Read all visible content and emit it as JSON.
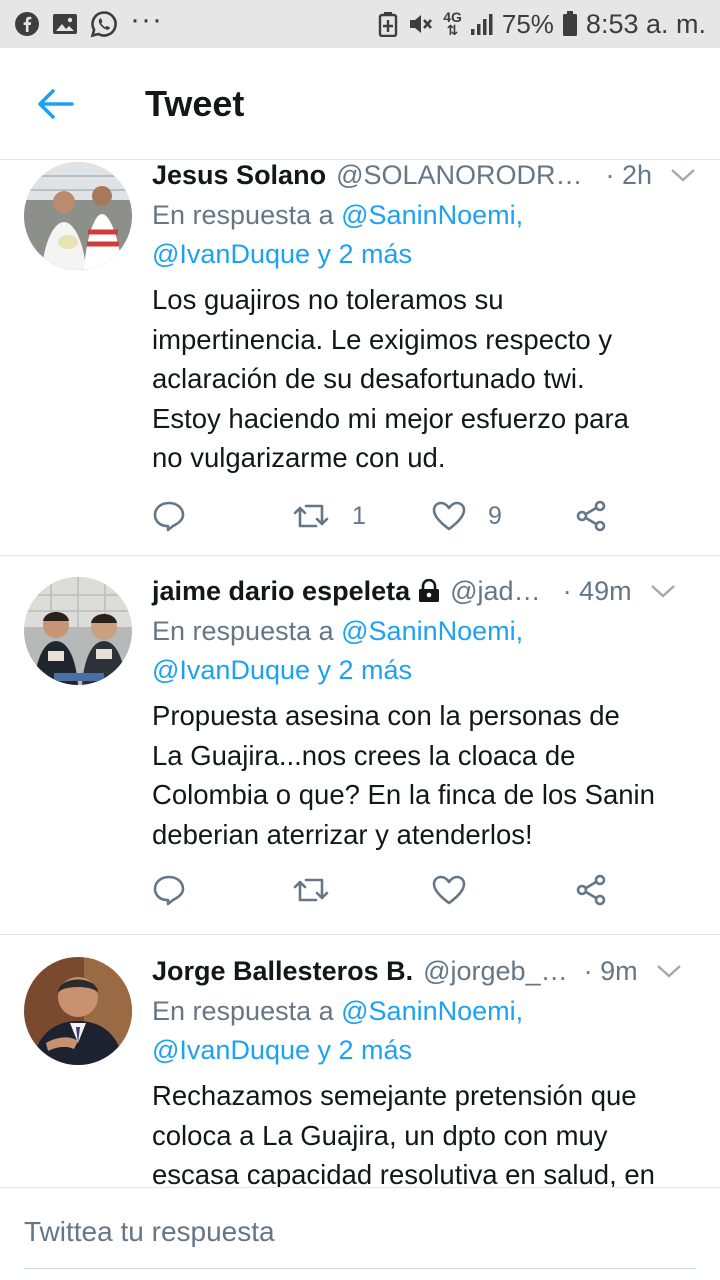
{
  "status_bar": {
    "left_icons": [
      "facebook-icon",
      "gallery-icon",
      "whatsapp-icon",
      "more-icon"
    ],
    "more_glyph": "···",
    "network_top": "4G",
    "network_bottom": "⇅",
    "battery": "75%",
    "time": "8:53 a. m."
  },
  "header": {
    "title": "Tweet"
  },
  "tweets": [
    {
      "name": "Jesus Solano",
      "handle": "@SOLANORODRI…",
      "time": "· 2h",
      "reply_prefix": "En respuesta a",
      "reply_mention1": "@SaninNoemi,",
      "reply_line2": "@IvanDuque y 2 más",
      "text": "Los guajiros no toleramos su\nimpertinencia. Le exigimos respecto y\naclaración de su desafortunado twi.\nEstoy haciendo mi mejor esfuerzo para\nno vulgarizarme con ud.",
      "retweets": "1",
      "likes": "9"
    },
    {
      "name": "jaime dario espeleta",
      "handle": "@jad…",
      "time": "· 49m",
      "reply_prefix": "En respuesta a",
      "reply_mention1": "@SaninNoemi,",
      "reply_line2": "@IvanDuque y 2 más",
      "text": "Propuesta asesina con la personas de\nLa Guajira...nos crees la cloaca de\nColombia o que? En la finca de los Sanin\ndeberian aterrizar y atenderlos!"
    },
    {
      "name": "Jorge Ballesteros B.",
      "handle": "@jorgeb_…",
      "time": "· 9m",
      "reply_prefix": "En respuesta a",
      "reply_mention1": "@SaninNoemi,",
      "reply_line2": "@IvanDuque y 2 más",
      "text": "Rechazamos semejante pretensión que\ncoloca a La Guajira, un dpto con muy\nescasa capacidad resolutiva en salud, en"
    }
  ],
  "compose": {
    "placeholder": "Twittea tu respuesta"
  },
  "colors": {
    "accent": "#1da1f2",
    "muted": "#657786",
    "text": "#14171a",
    "divider": "#e1e8ed"
  }
}
